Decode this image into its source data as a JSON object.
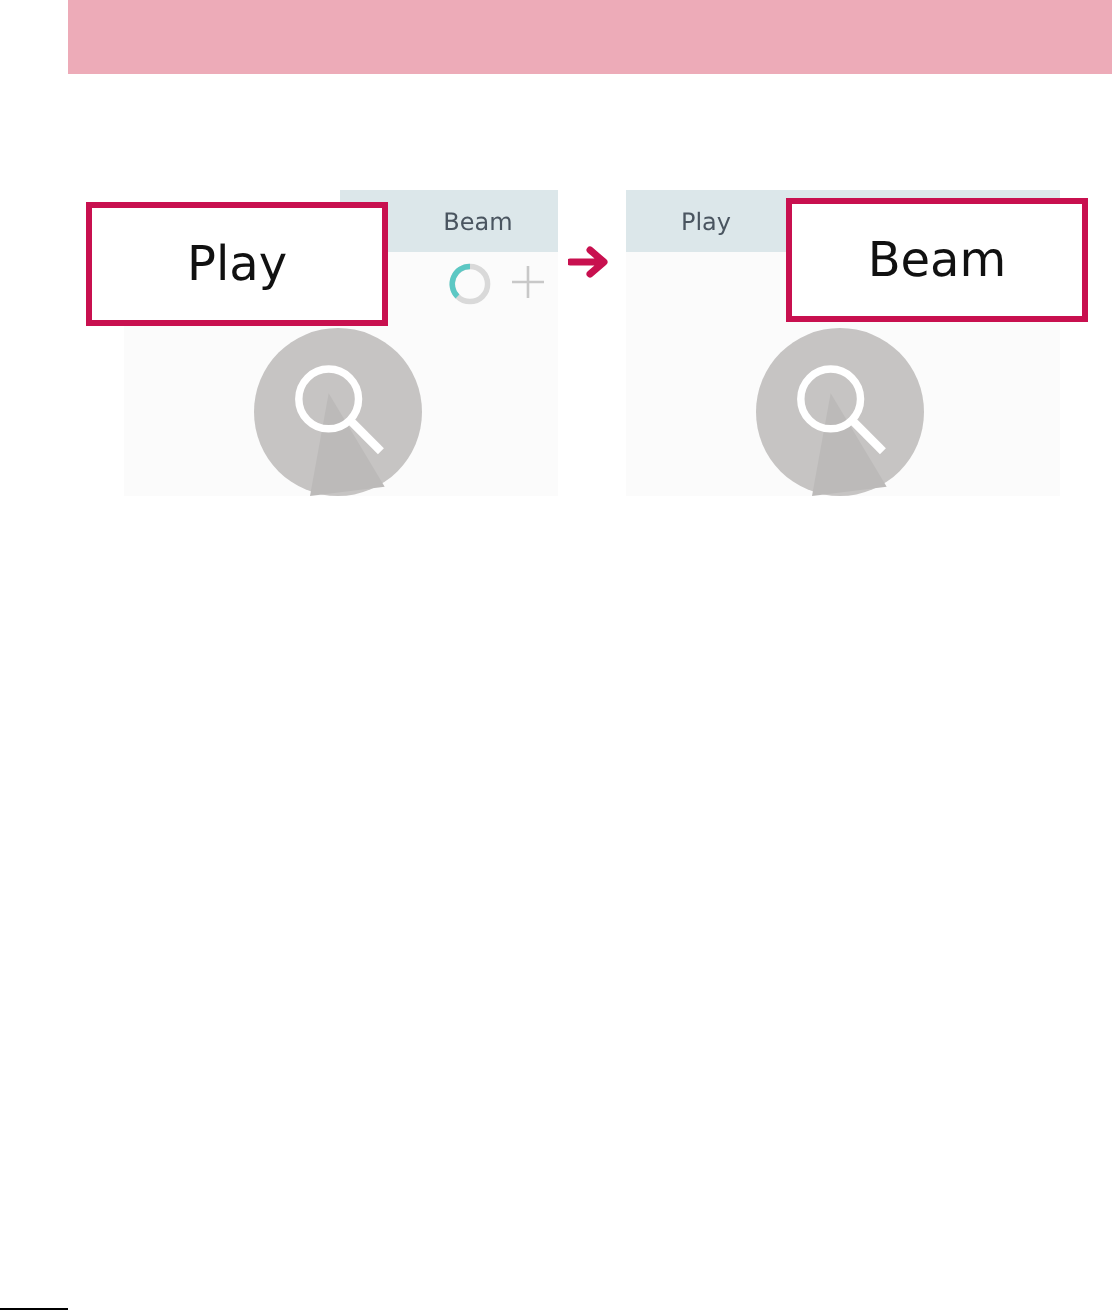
{
  "screens": [
    {
      "tab": {
        "label": "Beam",
        "selected": false
      },
      "callout": "Play",
      "loading": true
    },
    {
      "tab": {
        "label": "Play",
        "selected": false
      },
      "callout": "Beam",
      "loading": false
    }
  ]
}
